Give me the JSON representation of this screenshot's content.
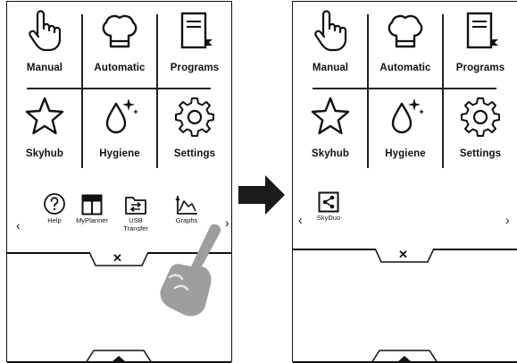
{
  "left_screen": {
    "tiles": [
      {
        "label": "Manual",
        "icon": "hand-pointer-icon"
      },
      {
        "label": "Automatic",
        "icon": "chef-hat-icon"
      },
      {
        "label": "Programs",
        "icon": "recipe-book-icon"
      },
      {
        "label": "Skyhub",
        "icon": "star-icon"
      },
      {
        "label": "Hygiene",
        "icon": "water-drop-sparkle-icon"
      },
      {
        "label": "Settings",
        "icon": "gear-icon"
      }
    ],
    "strip_items": [
      {
        "label": "Help",
        "icon": "question-circle-icon"
      },
      {
        "label": "MyPlanner",
        "icon": "planner-icon"
      },
      {
        "label": "USB\nTransfer",
        "icon": "usb-transfer-icon"
      },
      {
        "label": "Graphs",
        "icon": "graph-icon"
      }
    ],
    "prev_arrow": "‹",
    "next_arrow": "›",
    "close_symbol": "✕"
  },
  "right_screen": {
    "tiles": [
      {
        "label": "Manual",
        "icon": "hand-pointer-icon"
      },
      {
        "label": "Automatic",
        "icon": "chef-hat-icon"
      },
      {
        "label": "Programs",
        "icon": "recipe-book-icon"
      },
      {
        "label": "Skyhub",
        "icon": "star-icon"
      },
      {
        "label": "Hygiene",
        "icon": "water-drop-sparkle-icon"
      },
      {
        "label": "Settings",
        "icon": "gear-icon"
      }
    ],
    "strip_items": [
      {
        "label": "SkyDuo",
        "icon": "share-icon"
      }
    ],
    "prev_arrow": "‹",
    "next_arrow": "›",
    "close_symbol": "✕"
  },
  "transition_arrow": "right-arrow-icon",
  "gesture": "swipe-finger-icon"
}
